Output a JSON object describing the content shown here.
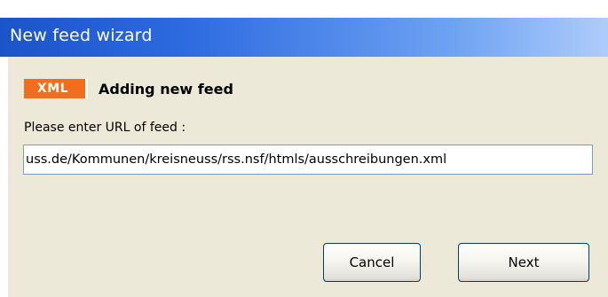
{
  "window": {
    "title": "New feed wizard"
  },
  "header": {
    "badge_text": "XML",
    "heading": "Adding new feed"
  },
  "form": {
    "url_label": "Please enter URL of feed :",
    "url_value": "uss.de/Kommunen/kreisneuss/rss.nsf/htmls/ausschreibungen.xml"
  },
  "buttons": {
    "cancel_label": "Cancel",
    "next_label": "Next"
  },
  "colors": {
    "titlebar_start": "#1c53c9",
    "titlebar_end": "#aecdfa",
    "dialog_background": "#ece9d8",
    "xml_badge": "#f26d1e"
  }
}
